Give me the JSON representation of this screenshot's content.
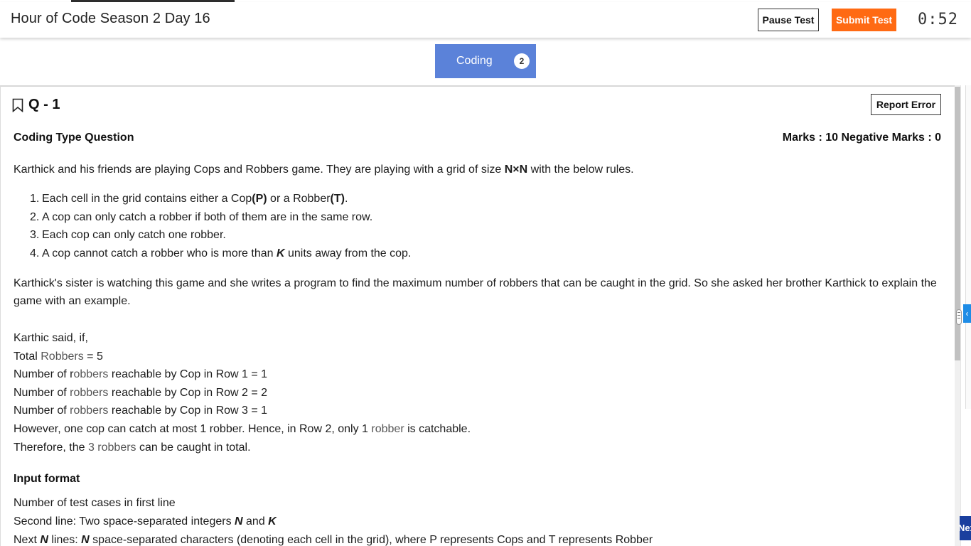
{
  "header": {
    "title": "Hour of Code Season 2 Day 16",
    "pause_label": "Pause Test",
    "submit_label": "Submit Test",
    "timer": "0:52"
  },
  "section": {
    "label": "Coding",
    "count": "2"
  },
  "question": {
    "number": "Q - 1",
    "report_label": "Report Error",
    "type": "Coding Type Question",
    "marks": "Marks : 10  Negative Marks : 0",
    "intro": {
      "t1": "Karthick and his friends are playing Cops and Robbers game. They are playing with a grid of size ",
      "t2": "N×N",
      "t3": " with the below rules."
    },
    "rules": {
      "r1": {
        "num": "1.",
        "a": "Each cell in the grid contains either a Cop",
        "b": "(P)",
        "c": " or a Robber",
        "d": "(T)",
        "e": "."
      },
      "r2": {
        "num": "2.",
        "a": "A cop can only catch a robber if both of them are in the same row."
      },
      "r3": {
        "num": "3.",
        "a": "Each cop can only catch one robber."
      },
      "r4": {
        "num": "4.",
        "a": "A cop cannot catch a robber who is more than ",
        "b": "K",
        "c": " units away from the cop."
      }
    },
    "sister": "Karthick's sister is watching this game and she writes a program to find the maximum number of robbers that can be caught in the grid. So she asked her brother Karthick to explain the game with an example.",
    "example": {
      "l1": "Karthic said, if,",
      "l2a": "Total ",
      "l2b": "Robbers",
      "l2c": " = 5",
      "l3a": "Number of r",
      "l3b": "obbers",
      "l3c": " reachable by Cop in Row 1 = 1",
      "l4a": "Number of ",
      "l4b": "robbers",
      "l4c": " reachable by Cop in Row 2 = 2",
      "l5a": "Number of ",
      "l5b": "robbers",
      "l5c": " reachable by Cop in Row 3 = 1",
      "l6a": "However, one cop can catch at most 1 robber. Hence, in Row 2, only 1 ",
      "l6b": "robber",
      "l6c": " is catchable.",
      "l7a": "Therefore, the ",
      "l7b": "3 robbers",
      "l7c": " can be caught in total."
    },
    "input_format": {
      "heading": "Input format",
      "l1": "Number of test cases in first line",
      "l2a": "Second line: Two space-separated integers ",
      "l2b": "N",
      "l2c": " and ",
      "l2d": "K",
      "l3a": "Next ",
      "l3b": "N",
      "l3c": " lines: ",
      "l3d": "N",
      "l3e": " space-separated characters (denoting each cell in the grid), where P represents Cops and T represents Robber"
    }
  },
  "side": {
    "next_label": "Next",
    "collapse_icon": "‹"
  },
  "icons": {
    "bookmark": "bookmark-icon",
    "collapse": "chevron-left-icon",
    "drag": "drag-handle-icon"
  },
  "colors": {
    "accent_orange": "#ff6a13",
    "section_blue": "#5b82d9",
    "next_blue": "#1a3f9e",
    "collapse_blue": "#1e8ce6"
  }
}
